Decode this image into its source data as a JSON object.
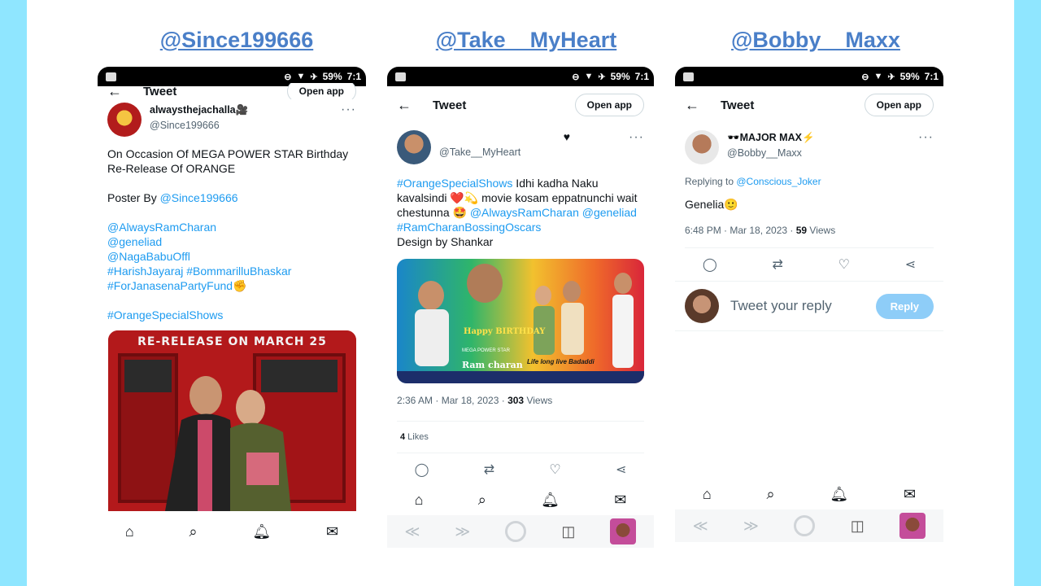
{
  "headers": [
    "@Since199666",
    "@Take__MyHeart",
    "@Bobby__Maxx"
  ],
  "status": {
    "battery": "59%",
    "time": "7:1"
  },
  "panel1": {
    "nav_title": "Tweet",
    "open_app": "Open app",
    "author_name": "alwaysthejachalla🎥",
    "author_handle": "@Since199666",
    "text1": "On Occasion Of MEGA POWER STAR Birthday Re-Release Of ORANGE",
    "poster_by": "Poster By ",
    "poster_link": "@Since199666",
    "mentions": [
      "@AlwaysRamCharan",
      "@geneliad",
      "@NagaBabuOffl",
      "#HarishJayaraj #BommarilluBhaskar",
      "#ForJanasenaPartyFund✊"
    ],
    "hashtag": "#OrangeSpecialShows",
    "image_banner": "RE-RELEASE ON MARCH 25"
  },
  "panel2": {
    "nav_title": "Tweet",
    "open_app": "Open app",
    "author_handle": "@Take__MyHeart",
    "tweet_hashtag": "#OrangeSpecialShows",
    "tweet_text": " Idhi kadha Naku kavalsindi ❤️💫 movie kosam eppatnunchi wait chestunna 🤩 ",
    "mention1": "@AlwaysRamCharan",
    "mention2": "@geneliad",
    "hashtag2": "#RamCharanBossingOscars",
    "design_by": "Design by Shankar",
    "poster_title": "Happy BIRTHDAY",
    "poster_name": "Ram charan",
    "poster_sub": "MEGA POWER STAR",
    "poster_wish": "Life long live Badaddi",
    "timestamp": "2:36 AM · Mar 18, 2023 · ",
    "views_count": "303",
    "views_label": " Views",
    "likes_count": "4",
    "likes_label": " Likes"
  },
  "panel3": {
    "nav_title": "Tweet",
    "open_app": "Open app",
    "author_name": "🕶️MAJOR MAX⚡",
    "author_handle": "@Bobby__Maxx",
    "replying_label": "Replying to ",
    "replying_to": "@Conscious_Joker",
    "tweet_text": "Genelia🙂",
    "timestamp": "6:48 PM · Mar 18, 2023 · ",
    "views_count": "59",
    "views_label": " Views",
    "reply_placeholder": "Tweet your reply",
    "reply_button": "Reply"
  },
  "colors": {
    "accent": "#1d9bf0",
    "header_link": "#4a7fc8",
    "side_bar": "#8fe6ff"
  }
}
